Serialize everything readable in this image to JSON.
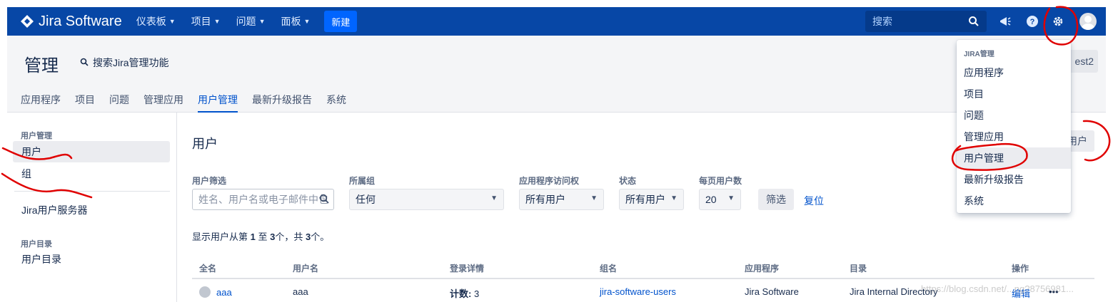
{
  "colors": {
    "topbar": "#0747a6",
    "create": "#0065ff",
    "link": "#0052cc",
    "annotation": "#e00000"
  },
  "topbar": {
    "brand": "Jira Software",
    "menu": [
      {
        "label": "仪表板",
        "icon": "chevron-down-icon"
      },
      {
        "label": "项目",
        "icon": "chevron-down-icon"
      },
      {
        "label": "问题",
        "icon": "chevron-down-icon"
      },
      {
        "label": "面板",
        "icon": "chevron-down-icon"
      }
    ],
    "create_label": "新建",
    "search_placeholder": "搜索"
  },
  "admin": {
    "title": "管理",
    "search_label": "搜索Jira管理功能",
    "tabs": [
      "应用程序",
      "项目",
      "问题",
      "管理应用",
      "用户管理",
      "最新升级报告",
      "系统"
    ],
    "active_tab": "用户管理",
    "partial_button": "est2"
  },
  "sidebar": {
    "section_user": "用户管理",
    "items_user": [
      "用户",
      "组"
    ],
    "item_server": "Jira用户服务器",
    "section_directory": "用户目录",
    "item_directory": "用户目录"
  },
  "main": {
    "heading": "用户",
    "filters": {
      "user_label": "用户筛选",
      "user_placeholder": "姓名、用户名或电子邮件中包",
      "group_label": "所属组",
      "group_value": "任何",
      "access_label": "应用程序访问权",
      "access_value": "所有用户",
      "status_label": "状态",
      "status_value": "所有用户",
      "perpage_label": "每页用户数",
      "perpage_value": "20",
      "filter_button": "筛选",
      "reset_link": "复位"
    },
    "summary": {
      "prefix": "显示用户从第 ",
      "from": "1",
      "mid": " 至 ",
      "to": "3",
      "suffix1": "个，共 ",
      "total": "3",
      "suffix2": "个。"
    },
    "add_user_partial": "用户",
    "table": {
      "headers": [
        "全名",
        "用户名",
        "登录详情",
        "组名",
        "应用程序",
        "目录",
        "操作"
      ],
      "rows": [
        {
          "fullname": "aaa",
          "username": "aaa",
          "login_label": "计数:",
          "login_count": "3",
          "group": "jira-software-users",
          "app": "Jira Software",
          "directory": "Jira Internal Directory",
          "action": "编辑",
          "more": "•••"
        }
      ]
    }
  },
  "dropdown": {
    "heading": "JIRA管理",
    "items": [
      "应用程序",
      "项目",
      "问题",
      "管理应用",
      "用户管理",
      "最新升级报告",
      "系统"
    ],
    "active": "用户管理"
  },
  "watermark": "https://blog.csdn.net/...ng?8756981..."
}
